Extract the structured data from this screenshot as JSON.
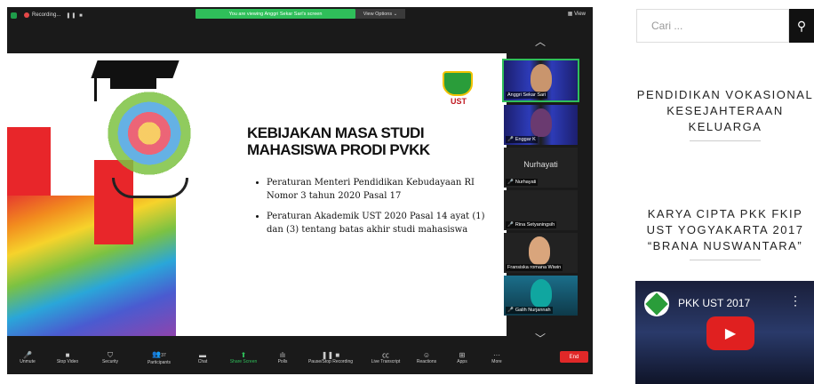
{
  "zoom": {
    "topbar": {
      "recording_label": "Recording...",
      "viewing_banner": "You are viewing Anggri Sekar Sari's screen",
      "view_options": "View Options ⌄",
      "view_label": "View"
    },
    "slide": {
      "logo_text": "UST",
      "title": "KEBIJAKAN MASA STUDI MAHASISWA PRODI PVKK",
      "bullets": [
        "Peraturan Menteri Pendidikan Kebudayaan RI Nomor 3 tahun 2020 Pasal 17",
        "Peraturan Akademik UST 2020 Pasal 14 ayat (1) dan (3) tentang batas akhir studi mahasiswa"
      ]
    },
    "participants": [
      {
        "name": "Anggri Sekar Sari",
        "active": true,
        "mic_muted": false
      },
      {
        "name": "Enggar K",
        "active": false,
        "mic_muted": true
      },
      {
        "name": "Nurhayati",
        "active": false,
        "mic_muted": true,
        "big_label": "Nurhayati"
      },
      {
        "name": "Rina Setyaningsih",
        "active": false,
        "mic_muted": true
      },
      {
        "name": "Fransiska romana Wiwin",
        "active": false,
        "mic_muted": false
      },
      {
        "name": "Galih Nurjannah",
        "active": false,
        "mic_muted": true
      }
    ],
    "toolbar": {
      "unmute": "Unmute",
      "stop_video": "Stop Video",
      "security": "Security",
      "participants": "Participants",
      "participants_count": "37",
      "chat": "Chat",
      "share_screen": "Share Screen",
      "polls": "Polls",
      "pause_recording": "Pause/Stop Recording",
      "live_transcript": "Live Transcript",
      "reactions": "Reactions",
      "apps": "Apps",
      "more": "More",
      "end": "End"
    },
    "colors": {
      "accent_green": "#2fbf5a",
      "end_red": "#e02828",
      "muted_red": "#e54848"
    }
  },
  "sidebar": {
    "search_placeholder": "Cari ...",
    "heading1": "PENDIDIKAN VOKASIONAL KESEJAHTERAAN KELUARGA",
    "heading2": "KARYA CIPTA PKK FKIP UST YOGYAKARTA 2017 “BRANA NUSWANTARA”",
    "video_title": "PKK UST 2017"
  }
}
